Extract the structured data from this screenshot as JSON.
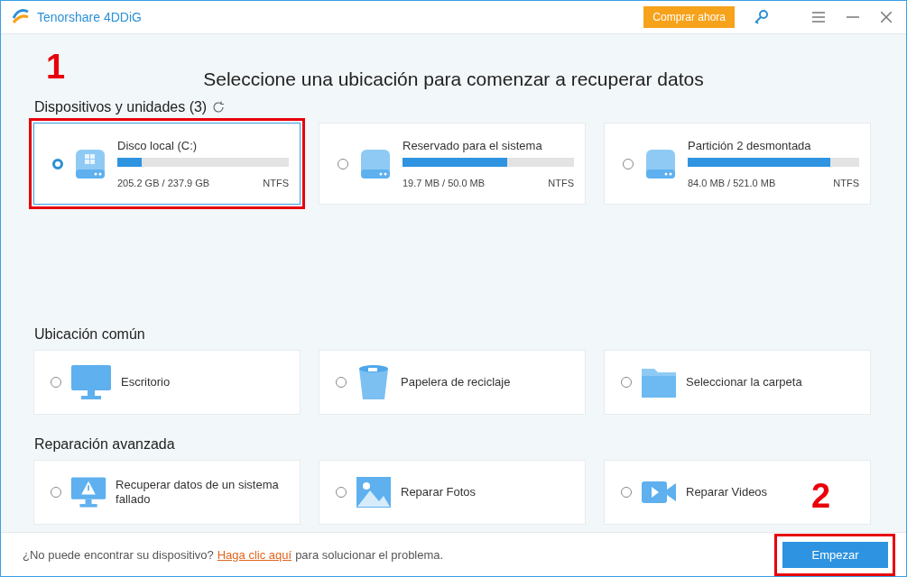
{
  "window": {
    "title": "Tenorshare 4DDiG",
    "buy_button": "Comprar ahora"
  },
  "heading": "Seleccione una ubicación para comenzar a recuperar datos",
  "annotations": [
    {
      "text": "1"
    },
    {
      "text": "2"
    }
  ],
  "devices": {
    "title": "Dispositivos y unidades (3)",
    "items": [
      {
        "name": "Disco local (C:)",
        "size": "205.2 GB / 237.9 GB",
        "fs": "NTFS",
        "level": 0.14,
        "selected": true,
        "highlighted": true,
        "kind": "windows"
      },
      {
        "name": "Reservado para el sistema",
        "size": "19.7 MB / 50.0 MB",
        "fs": "NTFS",
        "level": 0.61,
        "selected": false,
        "highlighted": false,
        "kind": "plain"
      },
      {
        "name": "Partición 2 desmontada",
        "size": "84.0 MB / 521.0 MB",
        "fs": "NTFS",
        "level": 0.83,
        "selected": false,
        "highlighted": false,
        "kind": "plain"
      }
    ]
  },
  "common": {
    "title": "Ubicación común",
    "items": [
      {
        "label": "Escritorio",
        "kind": "monitor",
        "selected": false
      },
      {
        "label": "Papelera de reciclaje",
        "kind": "trash",
        "selected": false
      },
      {
        "label": "Seleccionar la carpeta",
        "kind": "folder",
        "selected": false
      }
    ]
  },
  "advanced": {
    "title": "Reparación avanzada",
    "items": [
      {
        "label": "Recuperar datos de un sistema fallado",
        "kind": "warning",
        "selected": false
      },
      {
        "label": "Reparar Fotos",
        "kind": "photo",
        "selected": false
      },
      {
        "label": "Reparar Videos",
        "kind": "video",
        "selected": false
      }
    ]
  },
  "footer": {
    "before": "¿No puede encontrar su dispositivo?",
    "link": "Haga clic aquí",
    "after": "para solucionar el problema.",
    "button": "Empezar",
    "button_highlighted": true
  }
}
